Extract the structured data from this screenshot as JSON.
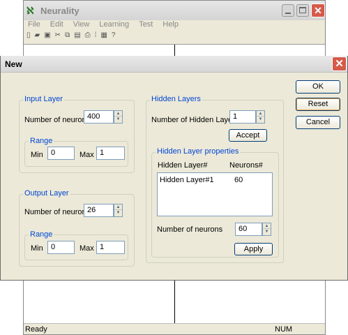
{
  "main_window": {
    "title": "Neurality",
    "menu": [
      "File",
      "Edit",
      "View",
      "Learning",
      "Test",
      "Help"
    ],
    "status_left": "Ready",
    "status_right": "NUM"
  },
  "dialog": {
    "title": "New",
    "buttons": {
      "ok": "OK",
      "reset": "Reset",
      "cancel": "Cancel"
    },
    "input_layer": {
      "title": "Input Layer",
      "neurons_label": "Number of neurons",
      "neurons_value": "400",
      "range_title": "Range",
      "min_label": "Min",
      "min_value": "0",
      "max_label": "Max",
      "max_value": "1"
    },
    "output_layer": {
      "title": "Output Layer",
      "neurons_label": "Number of neurons",
      "neurons_value": "26",
      "range_title": "Range",
      "min_label": "Min",
      "min_value": "0",
      "max_label": "Max",
      "max_value": "1"
    },
    "hidden_layers": {
      "title": "Hidden Layers",
      "count_label": "Number of Hidden Layers",
      "count_value": "1",
      "accept": "Accept",
      "props_title": "Hidden Layer properties",
      "col1": "Hidden Layer#",
      "col2": "Neurons#",
      "rows": [
        {
          "name": "Hidden Layer#1",
          "neurons": "60"
        }
      ],
      "neurons_label": "Number of neurons",
      "neurons_value": "60",
      "apply": "Apply"
    }
  }
}
